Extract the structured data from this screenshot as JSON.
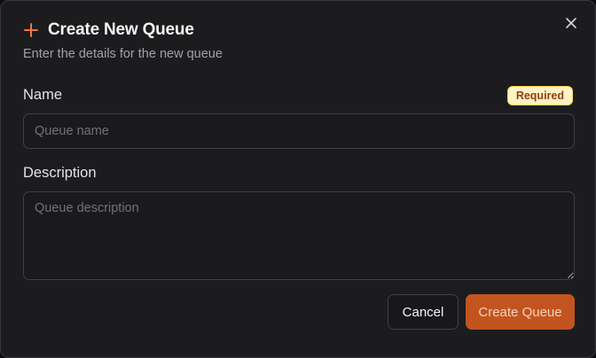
{
  "dialog": {
    "title": "Create New Queue",
    "subtitle": "Enter the details for the new queue",
    "title_icon": "plus-icon",
    "close_icon": "close-icon"
  },
  "form": {
    "name": {
      "label": "Name",
      "required_badge": "Required",
      "placeholder": "Queue name",
      "value": ""
    },
    "description": {
      "label": "Description",
      "placeholder": "Queue description",
      "value": ""
    }
  },
  "actions": {
    "cancel_label": "Cancel",
    "create_label": "Create Queue"
  },
  "colors": {
    "accent": "#c2541f",
    "plus_icon": "#f0773a",
    "badge_bg": "#fef3c7",
    "badge_text": "#92400e",
    "background": "#1c1c1e"
  }
}
